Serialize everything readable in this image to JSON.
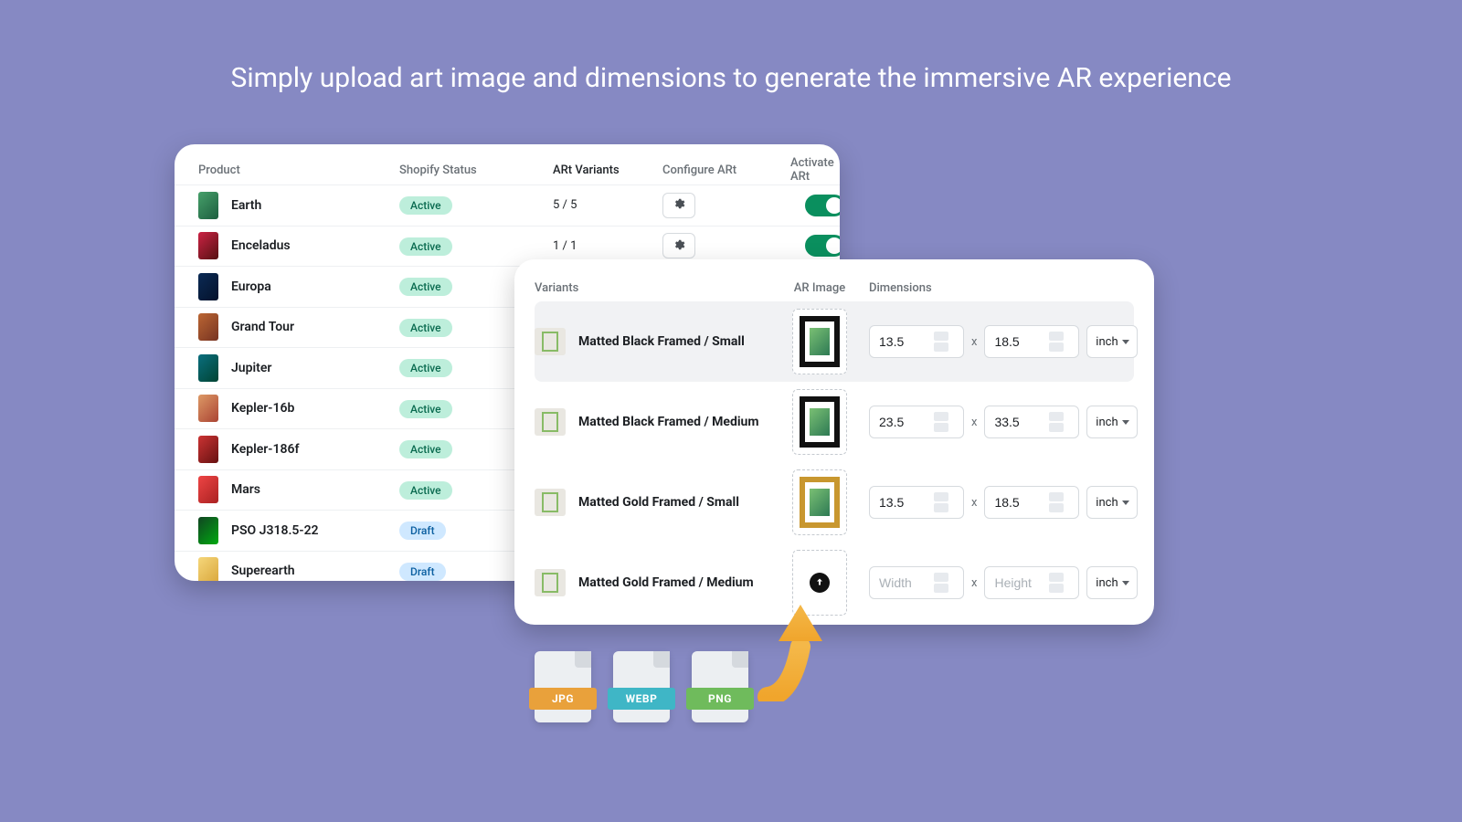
{
  "headline": "Simply upload art image and dimensions to generate the immersive AR experience",
  "products": {
    "columns": {
      "product": "Product",
      "status": "Shopify Status",
      "variants": "ARt Variants",
      "configure": "Configure ARt",
      "activate": "Activate ARt"
    },
    "status_values": {
      "active": "Active",
      "draft": "Draft"
    },
    "rows": [
      {
        "name": "Earth",
        "status": "active",
        "variants": "5 / 5",
        "has_extra": true
      },
      {
        "name": "Enceladus",
        "status": "active",
        "variants": "1 / 1",
        "has_extra": true
      },
      {
        "name": "Europa",
        "status": "active"
      },
      {
        "name": "Grand Tour",
        "status": "active"
      },
      {
        "name": "Jupiter",
        "status": "active"
      },
      {
        "name": "Kepler-16b",
        "status": "active"
      },
      {
        "name": "Kepler-186f",
        "status": "active"
      },
      {
        "name": "Mars",
        "status": "active"
      },
      {
        "name": "PSO J318.5-22",
        "status": "draft"
      },
      {
        "name": "Superearth",
        "status": "draft"
      }
    ]
  },
  "variants": {
    "columns": {
      "variants": "Variants",
      "ar_image": "AR Image",
      "dimensions": "Dimensions"
    },
    "separator": "x",
    "unit": "inch",
    "placeholders": {
      "width": "Width",
      "height": "Height"
    },
    "rows": [
      {
        "label": "Matted Black Framed / Small",
        "frame": "black",
        "width": "13.5",
        "height": "18.5",
        "selected": true
      },
      {
        "label": "Matted Black Framed / Medium",
        "frame": "black",
        "width": "23.5",
        "height": "33.5",
        "selected": false
      },
      {
        "label": "Matted Gold Framed / Small",
        "frame": "gold",
        "width": "13.5",
        "height": "18.5",
        "selected": false
      },
      {
        "label": "Matted Gold Framed / Medium",
        "frame": "upload",
        "width": "",
        "height": "",
        "selected": false
      }
    ]
  },
  "file_formats": [
    {
      "label": "JPG",
      "class": "fl-jpg"
    },
    {
      "label": "WEBP",
      "class": "fl-webp"
    },
    {
      "label": "PNG",
      "class": "fl-png"
    }
  ]
}
